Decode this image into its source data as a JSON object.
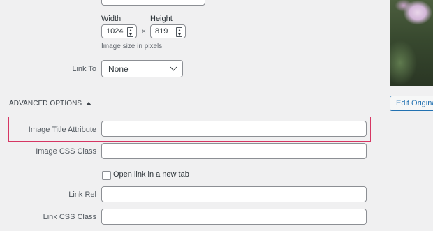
{
  "image_size": {
    "width_label": "Width",
    "height_label": "Height",
    "width_value": "1024",
    "height_value": "819",
    "separator": "×",
    "hint": "Image size in pixels"
  },
  "link_to": {
    "label": "Link To",
    "selected": "None"
  },
  "advanced_options": {
    "toggle_label": "ADVANCED OPTIONS",
    "image_title_label": "Image Title Attribute",
    "image_title_value": "",
    "image_css_label": "Image CSS Class",
    "image_css_value": "",
    "open_new_tab_label": "Open link in a new tab",
    "link_rel_label": "Link Rel",
    "link_rel_value": "",
    "link_css_label": "Link CSS Class",
    "link_css_value": ""
  },
  "sidebar": {
    "edit_original_label": "Edit Origina"
  },
  "colors": {
    "highlight_border": "#d63663",
    "button_accent": "#2271b1"
  }
}
